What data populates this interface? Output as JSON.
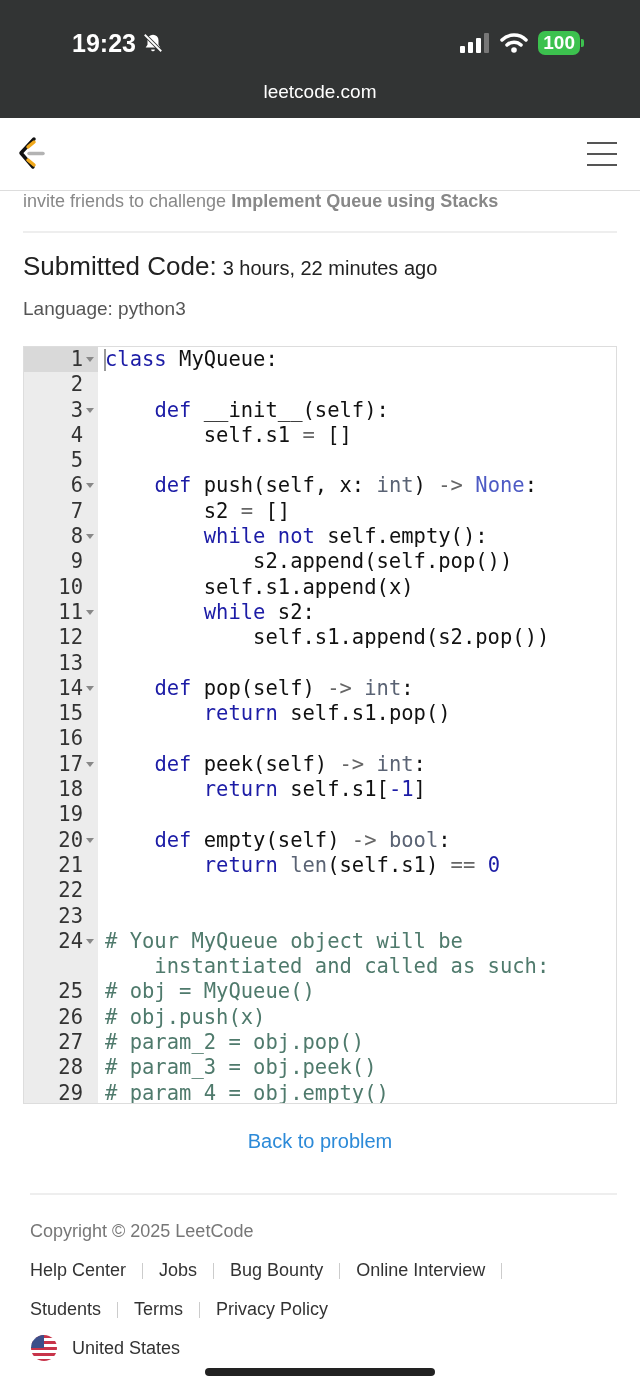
{
  "status_bar": {
    "time": "19:23",
    "silent": true,
    "battery": "100",
    "url": "leetcode.com"
  },
  "invite": "invite friends to challenge **Implement Queue using Stacks**",
  "heading": {
    "title": "Submitted Code:",
    "time": "3 hours, 22 minutes ago"
  },
  "language": "Language: python3",
  "code_lines": [
    {
      "number": "1",
      "foldable": true,
      "active": true,
      "tokens": [
        {
          "kind": "keyword",
          "text": "class"
        },
        {
          "kind": "plain",
          "text": " MyQueue:"
        }
      ]
    },
    {
      "number": "2",
      "foldable": false,
      "active": false
    },
    {
      "number": "3",
      "foldable": true,
      "active": false,
      "tokens": [
        {
          "kind": "keyword",
          "text": "    def"
        },
        {
          "kind": "plain",
          "text": " __init__(self):"
        }
      ]
    },
    {
      "number": "4",
      "foldable": false,
      "active": false,
      "tokens": [
        {
          "kind": "plain",
          "text": "        self.s1 "
        },
        {
          "kind": "operator",
          "text": "="
        },
        {
          "kind": "plain",
          "text": " []"
        }
      ]
    },
    {
      "number": "5",
      "foldable": false,
      "active": false
    },
    {
      "number": "6",
      "foldable": true,
      "active": false,
      "tokens": [
        {
          "kind": "keyword",
          "text": "    def"
        },
        {
          "kind": "plain",
          "text": " push(self, x: "
        },
        {
          "kind": "builtin",
          "text": "int"
        },
        {
          "kind": "plain",
          "text": ") "
        },
        {
          "kind": "operator",
          "text": "-> "
        },
        {
          "kind": "constant",
          "text": "None"
        },
        {
          "kind": "plain",
          "text": ":"
        }
      ]
    },
    {
      "number": "7",
      "foldable": false,
      "active": false,
      "tokens": [
        {
          "kind": "plain",
          "text": "        s2 "
        },
        {
          "kind": "operator",
          "text": "="
        },
        {
          "kind": "plain",
          "text": " []"
        }
      ]
    },
    {
      "number": "8",
      "foldable": true,
      "active": false,
      "tokens": [
        {
          "kind": "keyword",
          "text": "        while not"
        },
        {
          "kind": "plain",
          "text": " self.empty():"
        }
      ]
    },
    {
      "number": "9",
      "foldable": false,
      "active": false,
      "tokens": [
        {
          "kind": "plain",
          "text": "            s2.append(self.pop())"
        }
      ]
    },
    {
      "number": "10",
      "foldable": false,
      "active": false,
      "tokens": [
        {
          "kind": "plain",
          "text": "        self.s1.append(x)"
        }
      ]
    },
    {
      "number": "11",
      "foldable": true,
      "active": false,
      "tokens": [
        {
          "kind": "keyword",
          "text": "        while"
        },
        {
          "kind": "plain",
          "text": " s2:"
        }
      ]
    },
    {
      "number": "12",
      "foldable": false,
      "active": false,
      "tokens": [
        {
          "kind": "plain",
          "text": "            self.s1.append(s2.pop())"
        }
      ]
    },
    {
      "number": "13",
      "foldable": false,
      "active": false
    },
    {
      "number": "14",
      "foldable": true,
      "active": false,
      "tokens": [
        {
          "kind": "keyword",
          "text": "    def"
        },
        {
          "kind": "plain",
          "text": " pop(self) "
        },
        {
          "kind": "operator",
          "text": "-> "
        },
        {
          "kind": "builtin",
          "text": "int"
        },
        {
          "kind": "plain",
          "text": ":"
        }
      ]
    },
    {
      "number": "15",
      "foldable": false,
      "active": false,
      "tokens": [
        {
          "kind": "keyword",
          "text": "        return"
        },
        {
          "kind": "plain",
          "text": " self.s1.pop()"
        }
      ]
    },
    {
      "number": "16",
      "foldable": false,
      "active": false
    },
    {
      "number": "17",
      "foldable": true,
      "active": false,
      "tokens": [
        {
          "kind": "keyword",
          "text": "    def"
        },
        {
          "kind": "plain",
          "text": " peek(self) "
        },
        {
          "kind": "operator",
          "text": "-> "
        },
        {
          "kind": "builtin",
          "text": "int"
        },
        {
          "kind": "plain",
          "text": ":"
        }
      ]
    },
    {
      "number": "18",
      "foldable": false,
      "active": false,
      "tokens": [
        {
          "kind": "keyword",
          "text": "        return"
        },
        {
          "kind": "plain",
          "text": " self.s1["
        },
        {
          "kind": "number",
          "text": "-1"
        },
        {
          "kind": "plain",
          "text": "]"
        }
      ]
    },
    {
      "number": "19",
      "foldable": false,
      "active": false
    },
    {
      "number": "20",
      "foldable": true,
      "active": false,
      "tokens": [
        {
          "kind": "keyword",
          "text": "    def"
        },
        {
          "kind": "plain",
          "text": " empty(self) "
        },
        {
          "kind": "operator",
          "text": "-> "
        },
        {
          "kind": "builtin",
          "text": "bool"
        },
        {
          "kind": "plain",
          "text": ":"
        }
      ]
    },
    {
      "number": "21",
      "foldable": false,
      "active": false,
      "tokens": [
        {
          "kind": "keyword",
          "text": "        return "
        },
        {
          "kind": "builtin",
          "text": "len"
        },
        {
          "kind": "plain",
          "text": "(self.s1) "
        },
        {
          "kind": "operator",
          "text": "== "
        },
        {
          "kind": "number",
          "text": "0"
        }
      ]
    },
    {
      "number": "22",
      "foldable": false,
      "active": false
    },
    {
      "number": "23",
      "foldable": false,
      "active": false
    },
    {
      "number": "24",
      "foldable": true,
      "active": false,
      "tokens": [
        {
          "kind": "comment",
          "text": "# Your MyQueue object will be instantiated and called as such:"
        }
      ]
    },
    {
      "number": "25",
      "foldable": false,
      "active": false,
      "tokens": [
        {
          "kind": "comment",
          "text": "# obj = MyQueue()"
        }
      ]
    },
    {
      "number": "26",
      "foldable": false,
      "active": false,
      "tokens": [
        {
          "kind": "comment",
          "text": "# obj.push(x)"
        }
      ]
    },
    {
      "number": "27",
      "foldable": false,
      "active": false,
      "tokens": [
        {
          "kind": "comment",
          "text": "# param_2 = obj.pop()"
        }
      ]
    },
    {
      "number": "28",
      "foldable": false,
      "active": false,
      "tokens": [
        {
          "kind": "comment",
          "text": "# param_3 = obj.peek()"
        }
      ]
    },
    {
      "number": "29",
      "foldable": false,
      "active": false,
      "tokens": [
        {
          "kind": "comment",
          "text": "# param_4 = obj.empty()"
        }
      ]
    }
  ],
  "back_link": "Back to problem",
  "footer": {
    "copyright": "Copyright © 2025 LeetCode",
    "link_rows": [
      [
        "Help Center",
        "Jobs",
        "Bug Bounty",
        "Online Interview"
      ],
      [
        "Students",
        "Terms",
        "Privacy Policy"
      ]
    ],
    "trailing_separator": true,
    "region": "United States"
  }
}
